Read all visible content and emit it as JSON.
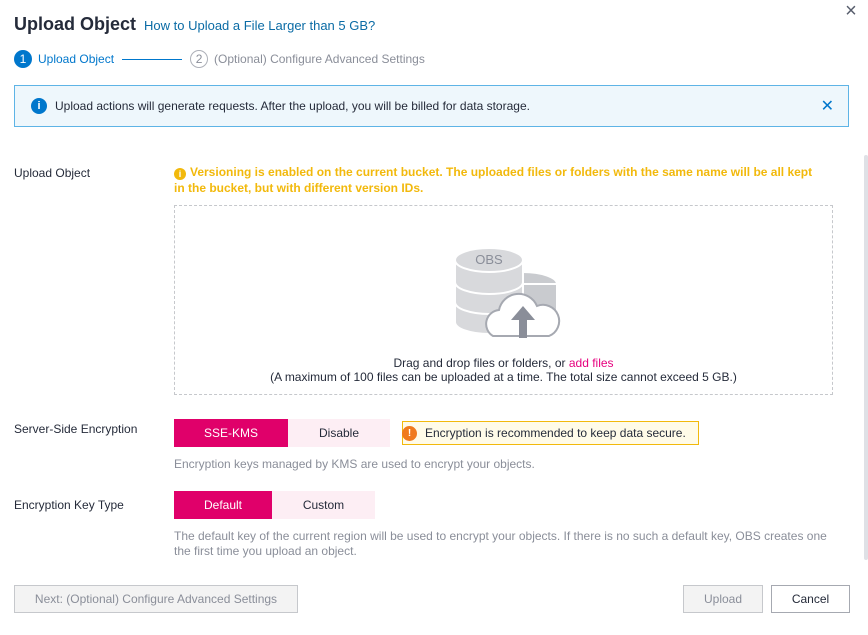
{
  "dialog": {
    "title": "Upload Object",
    "help_link": "How to Upload a File Larger than 5 GB?",
    "close_glyph": "×"
  },
  "steps": [
    {
      "number": "1",
      "label": "Upload Object",
      "state": "active"
    },
    {
      "number": "2",
      "label": "(Optional) Configure Advanced Settings",
      "state": "inactive"
    }
  ],
  "notice": {
    "icon": "info-icon",
    "text": "Upload actions will generate requests. After the upload, you will be billed for data storage.",
    "close_glyph": "✕"
  },
  "upload": {
    "label": "Upload Object",
    "warning": "Versioning is enabled on the current bucket. The uploaded files or folders with the same name will be all kept in the bucket, but with different version IDs.",
    "illustration_text": "OBS",
    "drop_text": "Drag and drop files or folders, or ",
    "add_files": "add files",
    "limit_text": "(A maximum of 100 files can be uploaded at a time. The total size cannot exceed 5 GB.)"
  },
  "encryption": {
    "label": "Server-Side Encryption",
    "options": [
      "SSE-KMS",
      "Disable"
    ],
    "selected": "SSE-KMS",
    "recommend": "Encryption is recommended to keep data secure.",
    "hint": "Encryption keys managed by KMS are used to encrypt your objects."
  },
  "key_type": {
    "label": "Encryption Key Type",
    "options": [
      "Default",
      "Custom"
    ],
    "selected": "Default",
    "hint": "The default key of the current region will be used to encrypt your objects. If there is no such a default key, OBS creates one the first time you upload an object."
  },
  "footer": {
    "next_label": "Next: (Optional) Configure Advanced Settings",
    "upload_label": "Upload",
    "cancel_label": "Cancel"
  },
  "colors": {
    "accent": "#e0006a",
    "primary_blue": "#0077cc",
    "warning": "#f2b90c"
  }
}
